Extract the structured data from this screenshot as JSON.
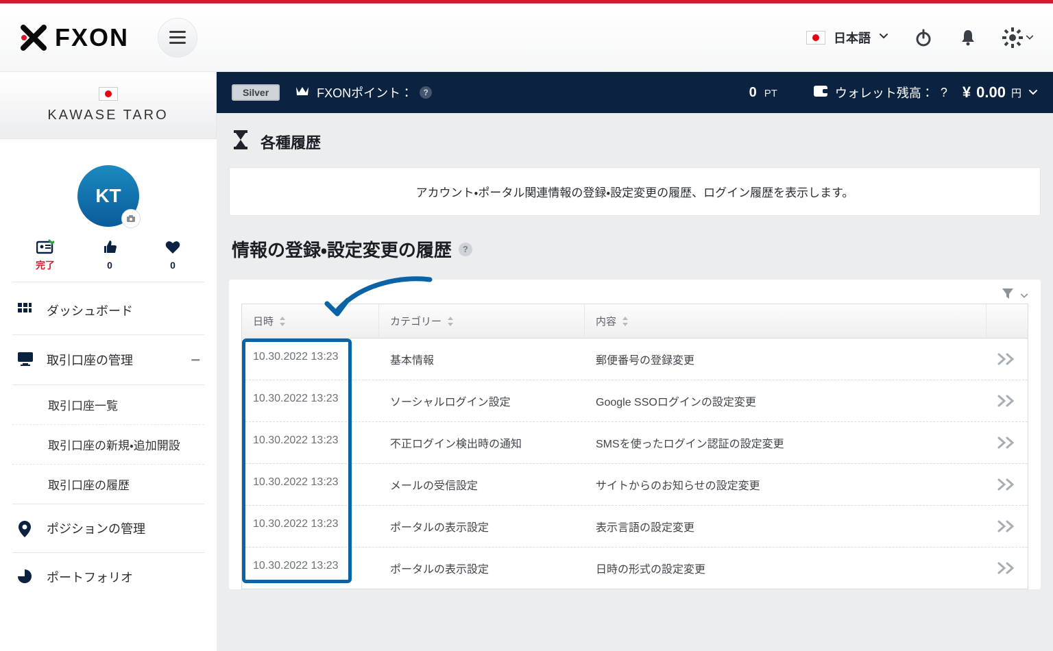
{
  "header": {
    "brand_text": "FXON",
    "language_label": "日本語"
  },
  "sidebar": {
    "user_name": "KAWASE TARO",
    "avatar_initials": "KT",
    "stats": {
      "complete_label": "完了",
      "likes": "0",
      "favorites": "0"
    },
    "nav": [
      {
        "label": "ダッシュボード"
      },
      {
        "label": "取引口座の管理",
        "expanded": true,
        "children": [
          "取引口座一覧",
          "取引口座の新規・追加開設",
          "取引口座の履歴"
        ]
      },
      {
        "label": "ポジションの管理"
      },
      {
        "label": "ポートフォリオ"
      }
    ]
  },
  "statusbar": {
    "tier": "Silver",
    "points_label": "FXONポイント：",
    "points_value": "0",
    "points_unit": "PT",
    "wallet_label": "ウォレット残高：",
    "balance_amount": "0.00",
    "balance_currency": "円"
  },
  "page": {
    "title": "各種履歴",
    "description": "アカウント・ポータル関連情報の登録・設定変更の履歴、ログイン履歴を表示します。"
  },
  "section": {
    "title": "情報の登録・設定変更の履歴"
  },
  "table": {
    "columns": {
      "datetime": "日時",
      "category": "カテゴリー",
      "content": "内容"
    },
    "rows": [
      {
        "dt": "10.30.2022 13:23",
        "cat": "基本情報",
        "content": "郵便番号の登録変更"
      },
      {
        "dt": "10.30.2022 13:23",
        "cat": "ソーシャルログイン設定",
        "content": "Google SSOログインの設定変更"
      },
      {
        "dt": "10.30.2022 13:23",
        "cat": "不正ログイン検出時の通知",
        "content": "SMSを使ったログイン認証の設定変更"
      },
      {
        "dt": "10.30.2022 13:23",
        "cat": "メールの受信設定",
        "content": "サイトからのお知らせの設定変更"
      },
      {
        "dt": "10.30.2022 13:23",
        "cat": "ポータルの表示設定",
        "content": "表示言語の設定変更"
      },
      {
        "dt": "10.30.2022 13:23",
        "cat": "ポータルの表示設定",
        "content": "日時の形式の設定変更"
      }
    ]
  }
}
